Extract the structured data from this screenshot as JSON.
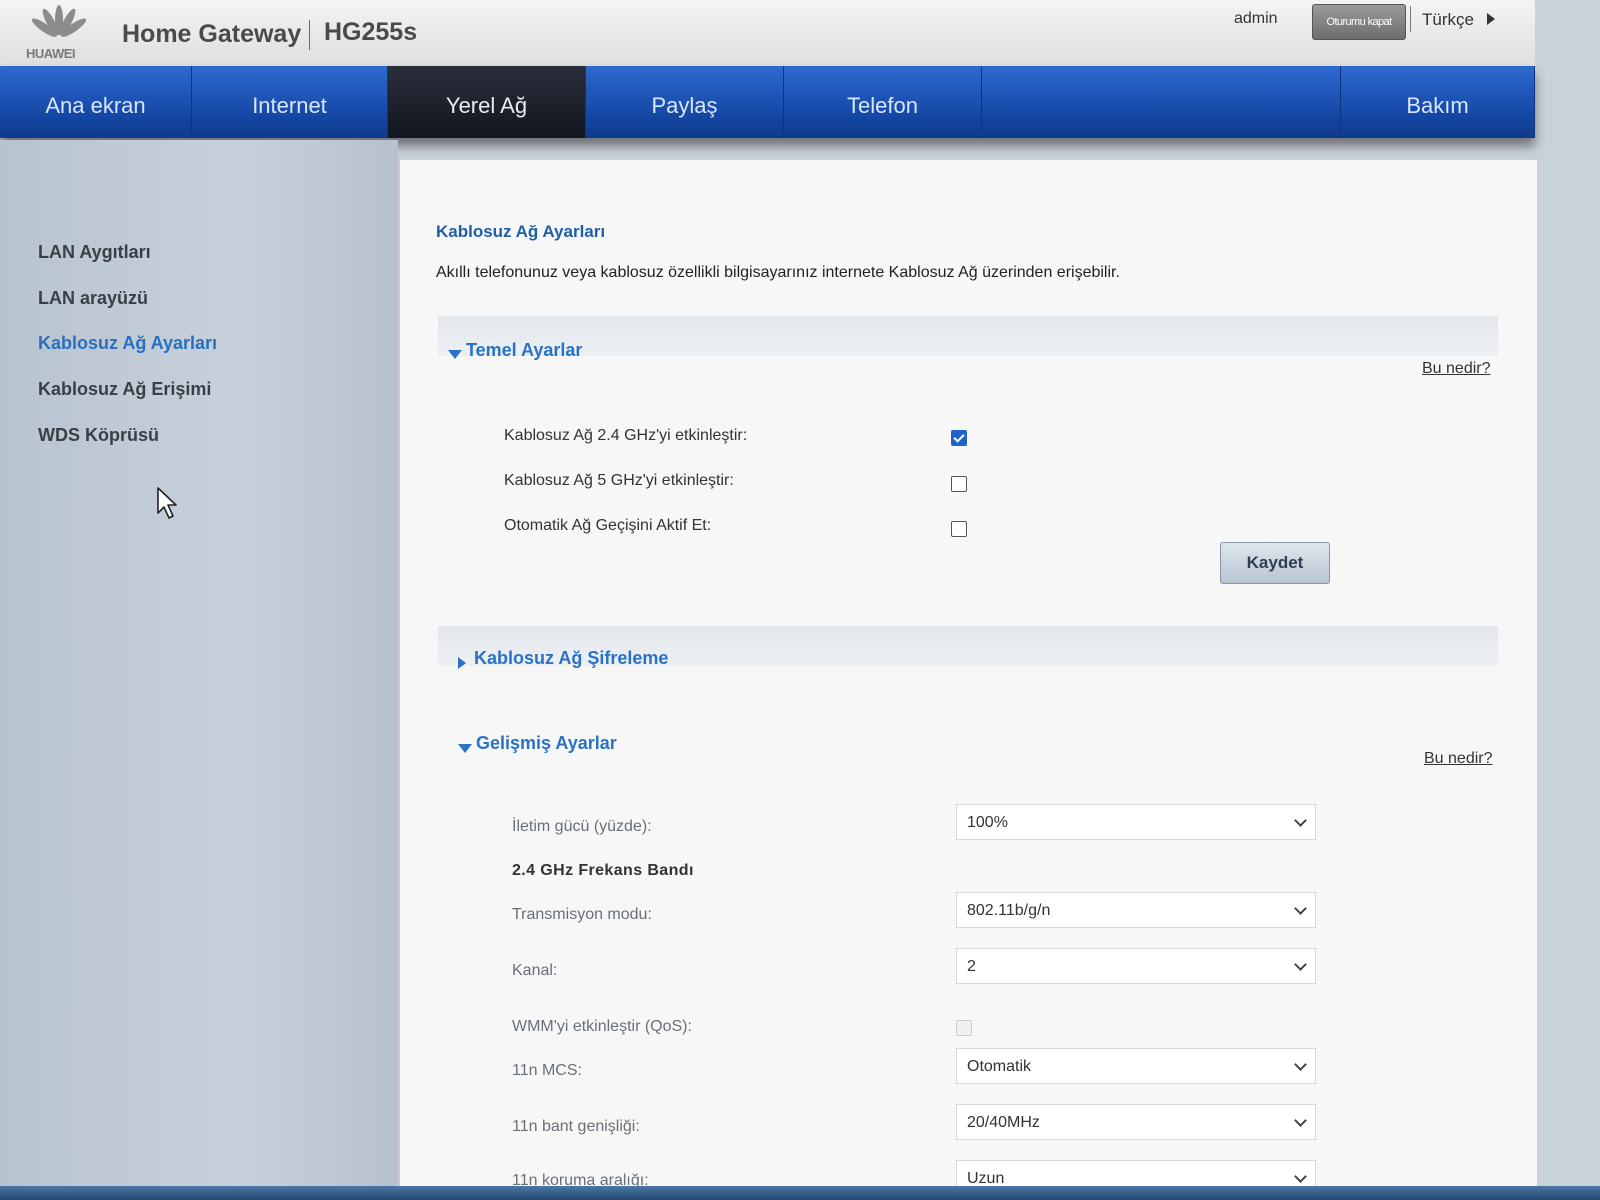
{
  "header": {
    "brand": "HUAWEI",
    "product": "Home Gateway",
    "model": "HG255s",
    "user": "admin",
    "logout": "Oturumu kapat",
    "language": "Türkçe"
  },
  "nav": {
    "tabs": [
      {
        "label": "Ana ekran"
      },
      {
        "label": "Internet"
      },
      {
        "label": "Yerel Ağ"
      },
      {
        "label": "Paylaş"
      },
      {
        "label": "Telefon"
      },
      {
        "label": "Bakım"
      }
    ],
    "active": "Yerel Ağ"
  },
  "sidebar": {
    "items": [
      {
        "label": "LAN Aygıtları"
      },
      {
        "label": "LAN arayüzü"
      },
      {
        "label": "Kablosuz Ağ Ayarları"
      },
      {
        "label": "Kablosuz Ağ Erişimi"
      },
      {
        "label": "WDS Köprüsü"
      }
    ],
    "active": "Kablosuz Ağ Ayarları"
  },
  "main": {
    "title": "Kablosuz Ağ Ayarları",
    "description": "Akıllı telefonunuz veya kablosuz özellikli bilgisayarınız internete Kablosuz Ağ üzerinden erişebilir.",
    "basic": {
      "title": "Temel Ayarlar",
      "help": "Bu nedir?",
      "enable_24": {
        "label": "Kablosuz Ağ 2.4 GHz'yi etkinleştir:",
        "checked": true
      },
      "enable_5": {
        "label": "Kablosuz Ağ 5 GHz'yi etkinleştir:",
        "checked": false
      },
      "auto_switch": {
        "label": "Otomatik Ağ Geçişini Aktif Et:",
        "checked": false
      },
      "save": "Kaydet"
    },
    "encryption": {
      "title": "Kablosuz Ağ Şifreleme"
    },
    "advanced": {
      "title": "Gelişmiş Ayarlar",
      "help": "Bu nedir?",
      "tx_power": {
        "label": "İletim gücü (yüzde):",
        "value": "100%"
      },
      "band_heading": "2.4 GHz Frekans Bandı",
      "mode": {
        "label": "Transmisyon modu:",
        "value": "802.11b/g/n"
      },
      "channel": {
        "label": "Kanal:",
        "value": "2"
      },
      "wmm": {
        "label": "WMM'yi etkinleştir (QoS):"
      },
      "mcs": {
        "label": "11n MCS:",
        "value": "Otomatik"
      },
      "bandwidth": {
        "label": "11n bant genişliği:",
        "value": "20/40MHz"
      },
      "guard": {
        "label": "11n koruma aralığı:",
        "value": "Uzun"
      }
    }
  }
}
